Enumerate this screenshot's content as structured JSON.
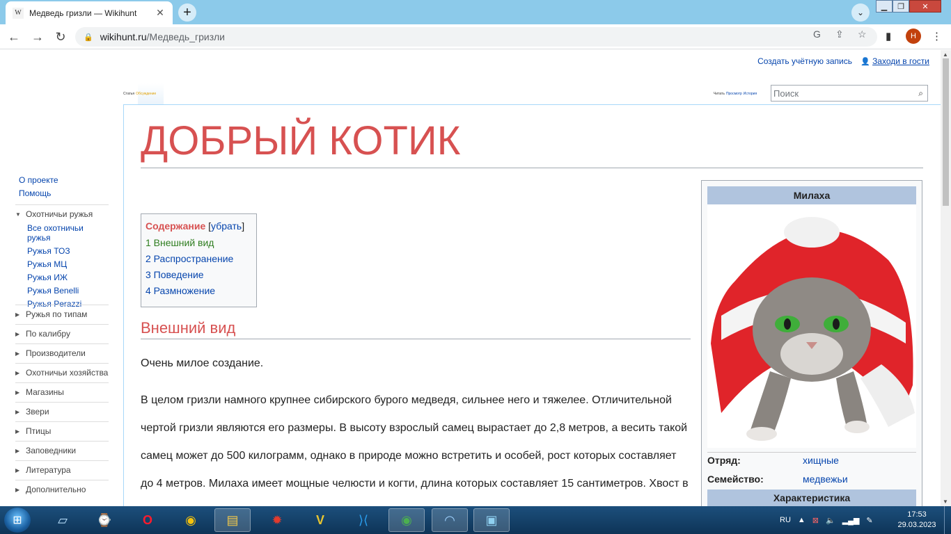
{
  "browser": {
    "tab_title": "Медведь гризли — Wikihunt",
    "tab_favicon": "W",
    "url_host": "wikihunt.ru",
    "url_path": "/Медведь_гризли",
    "profile_initial": "Н"
  },
  "personal": {
    "create_account": "Создать учётную запись",
    "login": "Заходи в гости"
  },
  "namespace_tabs": {
    "article": "Статья",
    "talk": "Обсуждение"
  },
  "view_tabs": {
    "read": "Читать",
    "view_source": "Просмотр",
    "history": "История"
  },
  "search": {
    "placeholder": "Поиск"
  },
  "page": {
    "title": "ДОБРЫЙ КОТИК",
    "section1_heading": "Внешний вид",
    "para1": "Очень милое создание.",
    "para2": "В целом гризли намного крупнее сибирского бурого медведя, сильнее него и тяжелее. Отличительной чертой гризли являются его размеры. В высоту взрослый самец вырастает до 2,8 метров, а весить такой самец может до 500 килограмм, однако в природе можно встретить и особей, рост которых составляет до 4 метров. Милаха имеет мощные челюсти и когти, длина которых составляет 15 сантиметров. Хвост в"
  },
  "toc": {
    "title": "Содержание",
    "toggle": "убрать",
    "items": [
      "1 Внешний вид",
      "2 Распространение",
      "3 Поведение",
      "4 Размножение"
    ]
  },
  "sidebar": {
    "top_links": [
      "О проекте",
      "Помощь"
    ],
    "expanded_group": {
      "title": "Охотничьи ружья",
      "items": [
        "Все охотничьи ружья",
        "Ружья ТОЗ",
        "Ружья МЦ",
        "Ружья ИЖ",
        "Ружья Benelli",
        "Ружья Perazzi"
      ]
    },
    "groups": [
      "Ружья по типам",
      "По калибру",
      "Производители",
      "Охотничьи хозяйства",
      "Магазины",
      "Звери",
      "Птицы",
      "Заповедники",
      "Литература",
      "Дополнительно"
    ]
  },
  "infobox": {
    "title": "Милаха",
    "image_desc_icon": "kitten-in-santa-hat-icon",
    "rows": [
      {
        "key": "Отряд:",
        "value": "хищные"
      },
      {
        "key": "Семейство:",
        "value": "медвежьи"
      }
    ],
    "subheader": "Характеристика"
  },
  "taskbar": {
    "tray_lang": "RU",
    "time": "17:53",
    "date": "29.03.2023"
  },
  "colors": {
    "heading_red": "#d75151",
    "link_blue": "#0645ad",
    "infobox_header": "#b0c4de",
    "chrome_tabstrip": "#8ccaea"
  }
}
